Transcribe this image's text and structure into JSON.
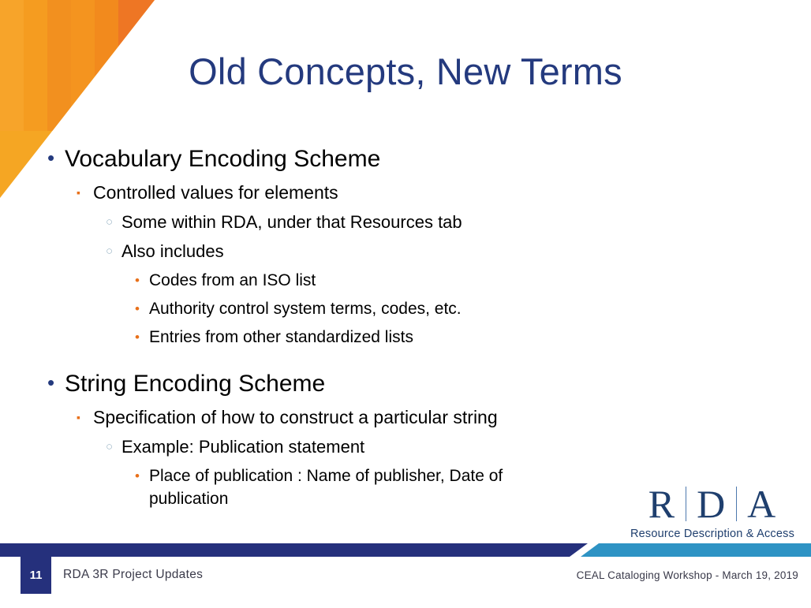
{
  "slide": {
    "title": "Old Concepts, New Terms",
    "page_number": "11",
    "footer_left": "RDA 3R Project Updates",
    "footer_right": "CEAL Cataloging Workshop  - March 19, 2019"
  },
  "bullets": {
    "marks": {
      "level1": "•",
      "level2": "▪",
      "level3": "○",
      "level4": "•"
    },
    "groups": [
      {
        "heading": "Vocabulary Encoding Scheme",
        "items": [
          {
            "level": 2,
            "text": "Controlled values for elements"
          },
          {
            "level": 3,
            "text": "Some within RDA, under that Resources tab"
          },
          {
            "level": 3,
            "text": "Also includes"
          },
          {
            "level": 4,
            "text": "Codes from an ISO list"
          },
          {
            "level": 4,
            "text": "Authority control system terms, codes, etc."
          },
          {
            "level": 4,
            "text": "Entries from other standardized lists"
          }
        ]
      },
      {
        "heading": "String Encoding Scheme",
        "items": [
          {
            "level": 2,
            "text": "Specification of how to construct a particular string"
          },
          {
            "level": 3,
            "text": "Example: Publication statement"
          },
          {
            "level": 4,
            "text": "Place of publication : Name of publisher, Date of publication"
          }
        ]
      }
    ]
  },
  "logo": {
    "letters": [
      "R",
      "D",
      "A"
    ],
    "tagline": "Resource Description & Access"
  },
  "colors": {
    "title_navy": "#243A7E",
    "bar_navy": "#25307C",
    "bar_teal": "#2E93C4",
    "accent_orange": "#E8701A",
    "deco_orange_light": "#F5A623",
    "deco_orange_dark": "#EE7624",
    "logo_navy": "#1F3F6E"
  }
}
